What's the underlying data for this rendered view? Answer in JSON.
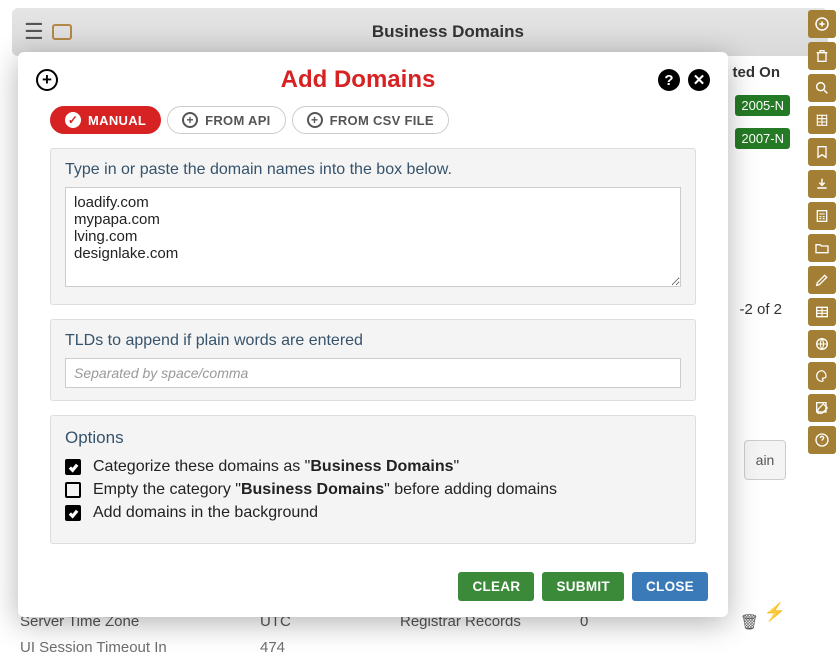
{
  "page": {
    "title": "Business Domains",
    "header_column": "ted On",
    "dates": [
      "2005-N",
      "2007-N"
    ],
    "result_count": "-2 of 2",
    "side_panel_fragment": "ain",
    "bottom_rows": [
      {
        "label": "Server Time Zone",
        "value": "UTC",
        "label2": "Registrar Records",
        "value2": "0"
      },
      {
        "label": "UI Session Timeout In",
        "value": "474",
        "label2": "",
        "value2": ""
      }
    ]
  },
  "modal": {
    "title": "Add Domains",
    "tabs": {
      "manual": "MANUAL",
      "api": "FROM API",
      "csv": "FROM CSV FILE"
    },
    "domain_label": "Type in or paste the domain names into the box below.",
    "domain_value": "loadify.com\nmypapa.com\nlving.com\ndesignlake.com",
    "tld_label": "TLDs to append if plain words are entered",
    "tld_placeholder": "Separated by space/comma",
    "options_title": "Options",
    "opt1_prefix": "Categorize these domains as \"",
    "opt1_bold": "Business Domains",
    "opt1_suffix": "\"",
    "opt2_prefix": "Empty the category \"",
    "opt2_bold": "Business Domains",
    "opt2_suffix": "\" before adding domains",
    "opt3": "Add domains in the background",
    "buttons": {
      "clear": "CLEAR",
      "submit": "SUBMIT",
      "close": "CLOSE"
    }
  },
  "right_strip_icons": [
    "add-circle-icon",
    "trash-icon",
    "search-icon",
    "grid-icon",
    "bookmark-icon",
    "download-icon",
    "calc-icon",
    "folder-open-icon",
    "pencil-icon",
    "table-icon",
    "globe-icon",
    "palette-icon",
    "compose-icon",
    "help-icon"
  ]
}
